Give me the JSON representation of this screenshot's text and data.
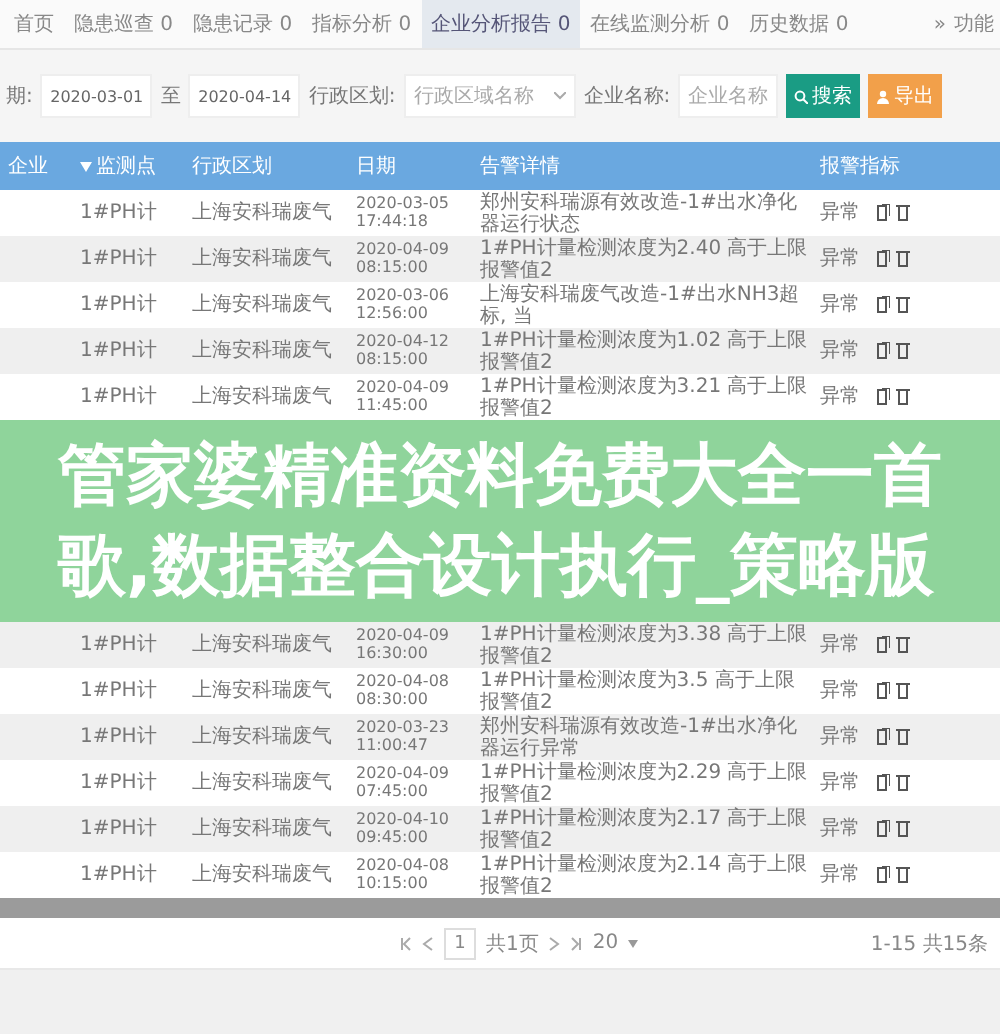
{
  "tabs": [
    {
      "label": "首页",
      "selected": false
    },
    {
      "label": "隐患巡查 0",
      "selected": false
    },
    {
      "label": "隐患记录 0",
      "selected": false
    },
    {
      "label": "指标分析 0",
      "selected": false
    },
    {
      "label": "企业分析报告 0",
      "selected": true
    },
    {
      "label": "在线监测分析 0",
      "selected": false
    },
    {
      "label": "历史数据 0",
      "selected": false
    }
  ],
  "tab_more": {
    "arrow": "»",
    "label": "功能"
  },
  "filters": {
    "date_label": "期:",
    "date_from": "2020-03-01",
    "to_label": "至",
    "date_to": "2020-04-14",
    "region_label": "行政区划:",
    "region_placeholder": "行政区域名称",
    "company_label": "企业名称:",
    "company_placeholder": "企业名称",
    "search_button": "搜索",
    "export_button": "导出"
  },
  "table": {
    "columns": [
      "企业",
      "监测点",
      "行政区划",
      "日期",
      "告警详情",
      "报警指标"
    ],
    "rows_top": [
      {
        "point": "1#PH计",
        "region": "上海安科瑞废气",
        "date": "2020-03-05",
        "time": "17:44:18",
        "detail": "郑州安科瑞源有效改造-1#出水净化器运行状态",
        "status": "异常"
      },
      {
        "point": "1#PH计",
        "region": "上海安科瑞废气",
        "date": "2020-04-09",
        "time": "08:15:00",
        "detail": "1#PH计量检测浓度为2.40 高于上限报警值2",
        "status": "异常"
      },
      {
        "point": "1#PH计",
        "region": "上海安科瑞废气",
        "date": "2020-03-06",
        "time": "12:56:00",
        "detail": "上海安科瑞废气改造-1#出水NH3超标, 当",
        "status": "异常"
      },
      {
        "point": "1#PH计",
        "region": "上海安科瑞废气",
        "date": "2020-04-12",
        "time": "08:15:00",
        "detail": "1#PH计量检测浓度为1.02 高于上限报警值2",
        "status": "异常"
      },
      {
        "point": "1#PH计",
        "region": "上海安科瑞废气",
        "date": "2020-04-09",
        "time": "11:45:00",
        "detail": "1#PH计量检测浓度为3.21 高于上限报警值2",
        "status": "异常"
      }
    ],
    "rows_bottom": [
      {
        "point": "1#PH计",
        "region": "上海安科瑞废气",
        "date": "2020-04-09",
        "time": "16:30:00",
        "detail": "1#PH计量检测浓度为3.38 高于上限报警值2",
        "status": "异常"
      },
      {
        "point": "1#PH计",
        "region": "上海安科瑞废气",
        "date": "2020-04-08",
        "time": "08:30:00",
        "detail": "1#PH计量检测浓度为3.5 高于上限报警值2",
        "status": "异常"
      },
      {
        "point": "1#PH计",
        "region": "上海安科瑞废气",
        "date": "2020-03-23",
        "time": "11:00:47",
        "detail": "郑州安科瑞源有效改造-1#出水净化器运行异常",
        "status": "异常"
      },
      {
        "point": "1#PH计",
        "region": "上海安科瑞废气",
        "date": "2020-04-09",
        "time": "07:45:00",
        "detail": "1#PH计量检测浓度为2.29 高于上限报警值2",
        "status": "异常"
      },
      {
        "point": "1#PH计",
        "region": "上海安科瑞废气",
        "date": "2020-04-10",
        "time": "09:45:00",
        "detail": "1#PH计量检测浓度为2.17 高于上限报警值2",
        "status": "异常"
      },
      {
        "point": "1#PH计",
        "region": "上海安科瑞废气",
        "date": "2020-04-08",
        "time": "10:15:00",
        "detail": "1#PH计量检测浓度为2.14 高于上限报警值2",
        "status": "异常"
      }
    ]
  },
  "banner": {
    "text": "管家婆精准资料免费大全一首歌,数据整合设计执行_策略版"
  },
  "pagination": {
    "page": "1",
    "total_pages": "共1页",
    "page_size": "20",
    "summary": "1-15 共15条"
  }
}
